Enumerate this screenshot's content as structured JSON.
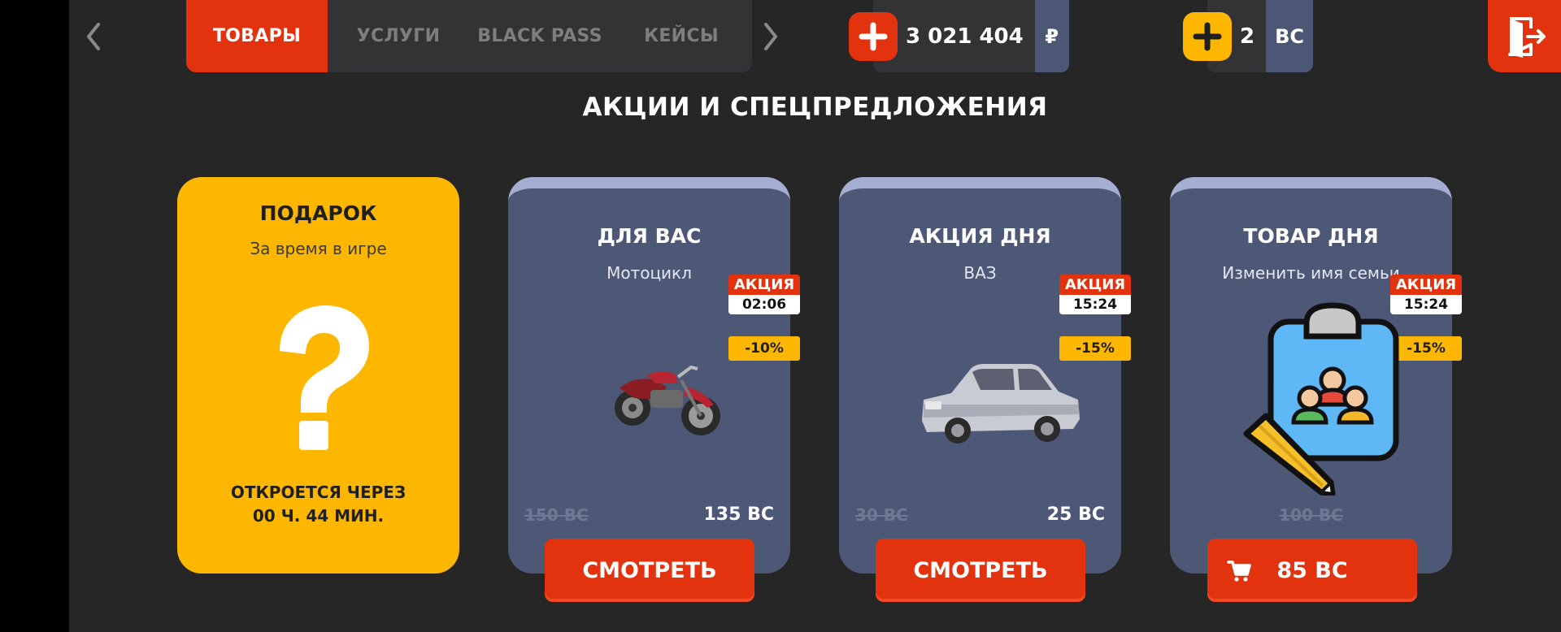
{
  "tabs": [
    {
      "label": "ТОВАРЫ",
      "active": true
    },
    {
      "label": "УСЛУГИ",
      "active": false
    },
    {
      "label": "BLACK PASS",
      "active": false
    },
    {
      "label": "КЕЙСЫ",
      "active": false
    }
  ],
  "balances": {
    "rub": {
      "amount": "3 021 404",
      "currency": "₽",
      "icon": "plus-icon",
      "color": "#e3320e"
    },
    "bc": {
      "amount": "2",
      "currency": "BC",
      "icon": "plus-icon",
      "color": "#fdb700"
    }
  },
  "icons": {
    "prev": "chevron-left-icon",
    "next": "chevron-right-icon",
    "exit": "exit-door-icon",
    "cart": "cart-icon"
  },
  "section_title": "АКЦИИ И СПЕЦПРЕДЛОЖЕНИЯ",
  "gift": {
    "title": "ПОДАРОК",
    "subtitle": "За время в игре",
    "icon": "question-mark-icon",
    "opens_line1": "ОТКРОЕТСЯ ЧЕРЕЗ",
    "opens_line2": "00 Ч. 44 МИН."
  },
  "offers": [
    {
      "title": "ДЛЯ ВАС",
      "subtitle": "Мотоцикл",
      "promo_label": "АКЦИЯ",
      "promo_time": "02:06",
      "discount": "-10%",
      "old_price": "150 BC",
      "new_price": "135 BC",
      "button": "СМОТРЕТЬ",
      "image": "motorcycle-image"
    },
    {
      "title": "АКЦИЯ ДНЯ",
      "subtitle": "ВАЗ",
      "promo_label": "АКЦИЯ",
      "promo_time": "15:24",
      "discount": "-15%",
      "old_price": "30 BC",
      "new_price": "25 BC",
      "button": "СМОТРЕТЬ",
      "image": "car-image"
    },
    {
      "title": "ТОВАР ДНЯ",
      "subtitle": "Изменить имя семьи",
      "promo_label": "АКЦИЯ",
      "promo_time": "15:24",
      "discount": "-15%",
      "old_price": "100 BC",
      "button": "85 BC",
      "image": "family-rename-image"
    }
  ],
  "colors": {
    "accent_red": "#e3320e",
    "accent_yellow": "#fdb700",
    "card_blue": "#4d5877",
    "background": "#262626"
  }
}
